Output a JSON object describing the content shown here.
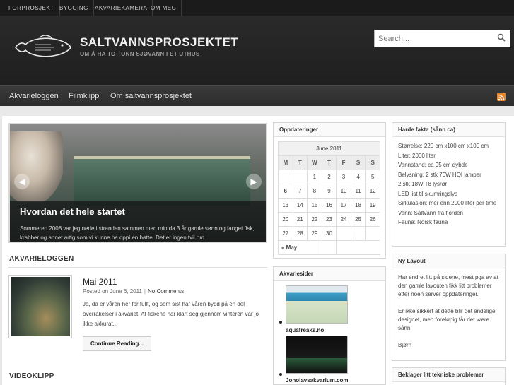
{
  "top_nav": [
    "FORPROSJEKT",
    "BYGGING",
    "AKVARIEKAMERA",
    "OM MEG"
  ],
  "site": {
    "title": "SALTVANNSPROSJEKTET",
    "tagline": "OM Å HA TO TONN SJØVANN I ET UTHUS"
  },
  "search": {
    "placeholder": "Search..."
  },
  "sub_nav": [
    "Akvarieloggen",
    "Filmklipp",
    "Om saltvannsprosjektet"
  ],
  "slider": {
    "title": "Hvordan det hele startet",
    "text": "Sommeren 2008 var jeg nede i stranden sammen med min da 3 år gamle sønn og fanget fisk, krabber og annet artig som vi kunne ha oppi en bøtte. Det er ingen tvil om"
  },
  "sections": {
    "akvarieloggen": "AKVARIELOGGEN",
    "videoklipp": "VIDEOKLIPP"
  },
  "post": {
    "title": "Mai 2011",
    "date": "Posted on June 6, 2011",
    "comments": "No Comments",
    "excerpt": "Ja, da er våren her for fullt, og som sist har våren bydd på en del overrakelser i akvariet. At fiskene har klart seg gjennom vinteren var jo ikke akkurat...",
    "read_more": "Continue Reading..."
  },
  "calendar_widget": {
    "title": "Oppdateringer",
    "month": "June 2011",
    "weekdays": [
      "M",
      "T",
      "W",
      "T",
      "F",
      "S",
      "S"
    ],
    "weeks": [
      [
        "",
        "",
        "1",
        "2",
        "3",
        "4",
        "5"
      ],
      [
        "6",
        "7",
        "8",
        "9",
        "10",
        "11",
        "12"
      ],
      [
        "13",
        "14",
        "15",
        "16",
        "17",
        "18",
        "19"
      ],
      [
        "20",
        "21",
        "22",
        "23",
        "24",
        "25",
        "26"
      ],
      [
        "27",
        "28",
        "29",
        "30",
        "",
        "",
        ""
      ]
    ],
    "prev": "« May"
  },
  "links_widget": {
    "title": "Akvariesider",
    "items": [
      "aquafreaks.no",
      "Jonolavsakvarium.com"
    ]
  },
  "facts_widget": {
    "title": "Harde fakta (sånn ca)",
    "lines": [
      "Størrelse: 220 cm x100 cm x100 cm",
      "Liter: 2000 liter",
      "Vannstand: ca 95 cm dybde",
      "Belysning: 2 stk 70W HQI lamper",
      "2 stk 18W T8 lysrør",
      "LED list til skumringslys",
      "Sirkulasjon: mer enn 2000 liter per time",
      "Vann: Saltvann fra fjorden",
      "Fauna: Norsk fauna"
    ]
  },
  "layout_widget": {
    "title": "Ny Layout",
    "p1": "Har endret litt på sidene, mest pga av at den gamle layouten fikk litt problemer etter noen server oppdateringer.",
    "p2": "Er ikke sikkert at dette blir det endelige designet, men foreløpig får det være sånn.",
    "sign": "Bjørn"
  },
  "tech_widget": {
    "title": "Beklager litt tekniske problemer"
  }
}
